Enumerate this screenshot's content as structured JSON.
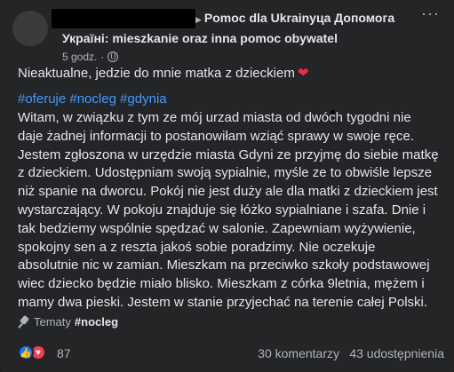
{
  "header": {
    "group_line1": "Pomoc dla Ukrainyцa Допомога",
    "group_line2": "Україні: mieszkanie oraz inna pomoc obywatel",
    "time": "5 godz.",
    "separator": "·",
    "more": "···"
  },
  "notice": "Nieaktualne, jedzie do mnie matka z dzieckiem",
  "hashtags": "#oferuje #nocleg #gdynia",
  "body_lines": [
    "Witam, w związku z tym ze mój urzad miasta od dwóch tygodni nie",
    "daje żadnej informacji to postanowiłam wziąć sprawy w swoje ręce.",
    "Jestem zgłoszona w urzędzie miasta Gdyni ze przyjmę do siebie matkę",
    "z dzieckiem. Udostępniam swoją sypialnie, myśle ze to obwiśle lepsze",
    "niż spanie na dworcu. Pokój nie jest duży ale dla matki z dzieckiem jest",
    "wystarczający. W pokoju znajduje się łóżko sypialniane i szafa. Dnie i",
    "tak bedziemy wspólnie spędzać w salonie. Zapewniam wyżywienie,",
    "spokojny sen a z reszta jakoś sobie poradzimy. Nie oczekuje",
    "absolutnie nic w zamian. Mieszkam na przeciwko szkoły podstawowej",
    "wiec dziecko będzie miało blisko. Mieszkam z córka 9letnia, mężem i",
    "mamy dwa pieski. Jestem w stanie przyjechać na terenie całej Polski."
  ],
  "topics": {
    "label": "Tematy",
    "tag": "#nocleg"
  },
  "stats": {
    "reactions": "87",
    "comments": "30 komentarzy",
    "shares": "43 udostępnienia"
  },
  "colors": {
    "background": "#242526",
    "text": "#e4e6eb",
    "secondary": "#b0b3b8",
    "link": "#4599ff",
    "like": "#1877f2",
    "love": "#f33e58"
  }
}
